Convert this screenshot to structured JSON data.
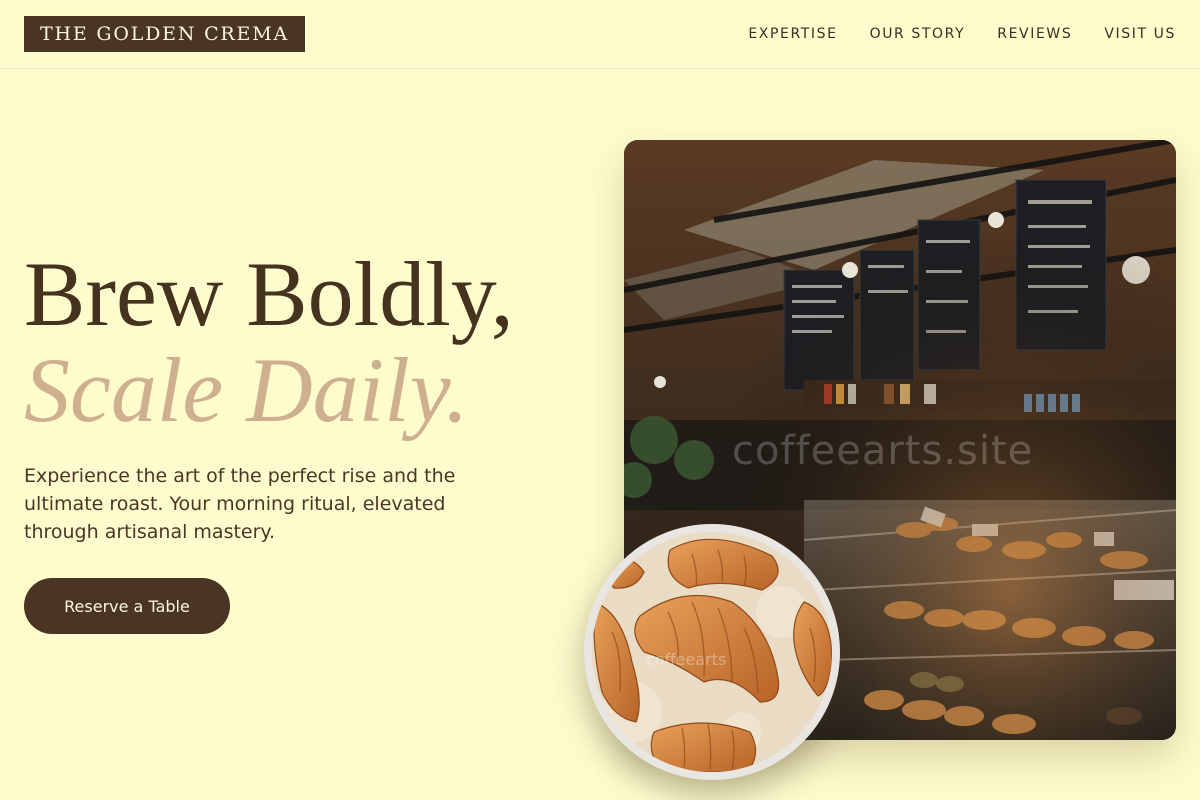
{
  "brand": {
    "name": "THE GOLDEN CREMA"
  },
  "nav": {
    "items": [
      {
        "label": "EXPERTISE"
      },
      {
        "label": "OUR STORY"
      },
      {
        "label": "REVIEWS"
      },
      {
        "label": "VISIT US"
      }
    ]
  },
  "hero": {
    "title_line1": "Brew Boldly,",
    "title_line2": "Scale Daily.",
    "description": "Experience the art of the perfect rise and the ultimate roast. Your morning ritual, elevated through artisanal mastery.",
    "cta_label": "Reserve a Table"
  },
  "images": {
    "main_watermark": "coffeearts.site",
    "circle_watermark": "coffeearts"
  },
  "colors": {
    "background": "#fefccd",
    "brand_dark": "#4a3424",
    "accent_tan": "#cfb08c"
  }
}
